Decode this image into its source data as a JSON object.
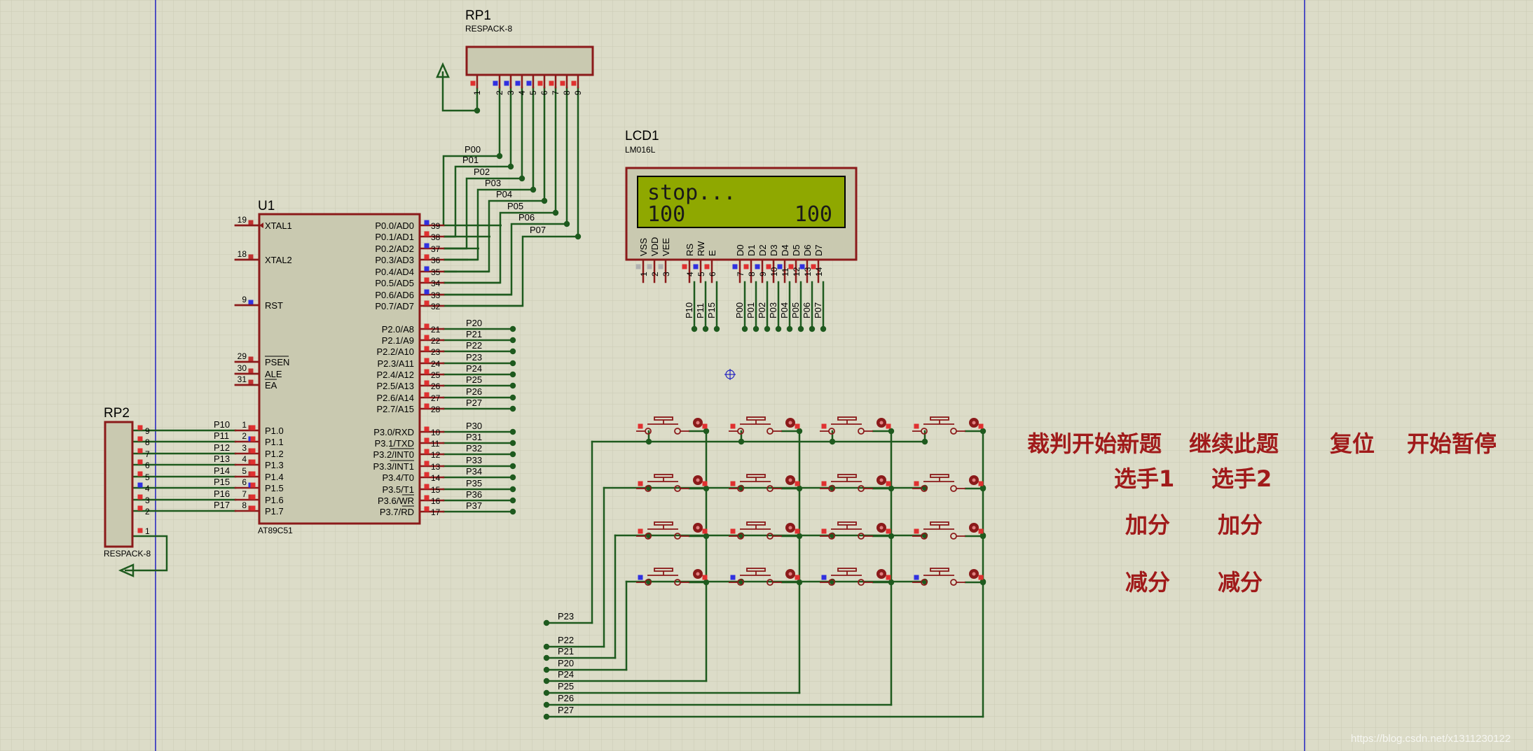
{
  "u1": {
    "ref": "U1",
    "part": "AT89C51",
    "left_pins": [
      {
        "num": "19",
        "name": "XTAL1"
      },
      {
        "num": "18",
        "name": "XTAL2"
      },
      {
        "num": "9",
        "name": "RST"
      },
      {
        "num": "29",
        "name": "PSEN"
      },
      {
        "num": "30",
        "name": "ALE"
      },
      {
        "num": "31",
        "name": "EA"
      },
      {
        "num": "1",
        "name": "P1.0"
      },
      {
        "num": "2",
        "name": "P1.1"
      },
      {
        "num": "3",
        "name": "P1.2"
      },
      {
        "num": "4",
        "name": "P1.3"
      },
      {
        "num": "5",
        "name": "P1.4"
      },
      {
        "num": "6",
        "name": "P1.5"
      },
      {
        "num": "7",
        "name": "P1.6"
      },
      {
        "num": "8",
        "name": "P1.7"
      }
    ],
    "p0_pins": [
      {
        "num": "39",
        "name": "P0.0/AD0",
        "net": "P00"
      },
      {
        "num": "38",
        "name": "P0.1/AD1",
        "net": "P01"
      },
      {
        "num": "37",
        "name": "P0.2/AD2",
        "net": "P02"
      },
      {
        "num": "36",
        "name": "P0.3/AD3",
        "net": "P03"
      },
      {
        "num": "35",
        "name": "P0.4/AD4",
        "net": "P04"
      },
      {
        "num": "34",
        "name": "P0.5/AD5",
        "net": "P05"
      },
      {
        "num": "33",
        "name": "P0.6/AD6",
        "net": "P06"
      },
      {
        "num": "32",
        "name": "P0.7/AD7",
        "net": "P07"
      }
    ],
    "p2_pins": [
      {
        "num": "21",
        "name": "P2.0/A8",
        "net": "P20"
      },
      {
        "num": "22",
        "name": "P2.1/A9",
        "net": "P21"
      },
      {
        "num": "23",
        "name": "P2.2/A10",
        "net": "P22"
      },
      {
        "num": "24",
        "name": "P2.3/A11",
        "net": "P23"
      },
      {
        "num": "25",
        "name": "P2.4/A12",
        "net": "P24"
      },
      {
        "num": "26",
        "name": "P2.5/A13",
        "net": "P25"
      },
      {
        "num": "27",
        "name": "P2.6/A14",
        "net": "P26"
      },
      {
        "num": "28",
        "name": "P2.7/A15",
        "net": "P27"
      }
    ],
    "p3_pins": [
      {
        "num": "10",
        "name": "P3.0/RXD",
        "net": "P30"
      },
      {
        "num": "11",
        "name": "P3.1/TXD",
        "net": "P31"
      },
      {
        "num": "12",
        "name": "P3.2/INT0",
        "net": "P32"
      },
      {
        "num": "13",
        "name": "P3.3/INT1",
        "net": "P33"
      },
      {
        "num": "14",
        "name": "P3.4/T0",
        "net": "P34"
      },
      {
        "num": "15",
        "name": "P3.5/T1",
        "net": "P35"
      },
      {
        "num": "16",
        "name": "P3.6/WR",
        "net": "P36"
      },
      {
        "num": "17",
        "name": "P3.7/RD",
        "net": "P37"
      }
    ]
  },
  "rp1": {
    "ref": "RP1",
    "part": "RESPACK-8",
    "pins": [
      "1",
      "2",
      "3",
      "4",
      "5",
      "6",
      "7",
      "8",
      "9"
    ]
  },
  "rp2": {
    "ref": "RP2",
    "part": "RESPACK-8",
    "pins": [
      {
        "num": "9",
        "net": "P10"
      },
      {
        "num": "8",
        "net": "P11"
      },
      {
        "num": "7",
        "net": "P12"
      },
      {
        "num": "6",
        "net": "P13"
      },
      {
        "num": "5",
        "net": "P14"
      },
      {
        "num": "4",
        "net": "P15"
      },
      {
        "num": "3",
        "net": "P16"
      },
      {
        "num": "2",
        "net": "P17"
      }
    ],
    "common_pin": "1"
  },
  "lcd1": {
    "ref": "LCD1",
    "part": "LM016L",
    "line1": "stop...",
    "line2_left": "100",
    "line2_right": "100",
    "pins": [
      {
        "num": "1",
        "name": "VSS",
        "net": ""
      },
      {
        "num": "2",
        "name": "VDD",
        "net": ""
      },
      {
        "num": "3",
        "name": "VEE",
        "net": ""
      },
      {
        "num": "4",
        "name": "RS",
        "net": "P10"
      },
      {
        "num": "5",
        "name": "RW",
        "net": "P11"
      },
      {
        "num": "6",
        "name": "E",
        "net": "P15"
      },
      {
        "num": "7",
        "name": "D0",
        "net": "P00"
      },
      {
        "num": "8",
        "name": "D1",
        "net": "P01"
      },
      {
        "num": "9",
        "name": "D2",
        "net": "P02"
      },
      {
        "num": "10",
        "name": "D3",
        "net": "P03"
      },
      {
        "num": "11",
        "name": "D4",
        "net": "P04"
      },
      {
        "num": "12",
        "name": "D5",
        "net": "P05"
      },
      {
        "num": "13",
        "name": "D6",
        "net": "P06"
      },
      {
        "num": "14",
        "name": "D7",
        "net": "P07"
      }
    ]
  },
  "keypad": {
    "row_nets": [
      "P23",
      "P22",
      "P21",
      "P20"
    ],
    "col_nets": [
      "P24",
      "P25",
      "P26",
      "P27"
    ]
  },
  "annotations": {
    "row1": [
      "裁判开始新题",
      "继续此题",
      "复位",
      "开始暂停"
    ],
    "row2": [
      "选手1",
      "选手2"
    ],
    "row3": [
      "加分",
      "加分"
    ],
    "row4": [
      "减分",
      "减分"
    ]
  },
  "watermark": "https://blog.csdn.net/x1311230122",
  "colors": {
    "background": "#dcdcc8",
    "grid": "#c9c9b3",
    "wire": "#1e5a1e",
    "component_border": "#8b1a1a",
    "component_fill": "#c9c9b0",
    "lcd_screen": "#8fa800",
    "pin_red": "#e03030",
    "pin_blue": "#3030e0",
    "annotation": "#a01a1a",
    "axis_line": "#2020c0"
  }
}
